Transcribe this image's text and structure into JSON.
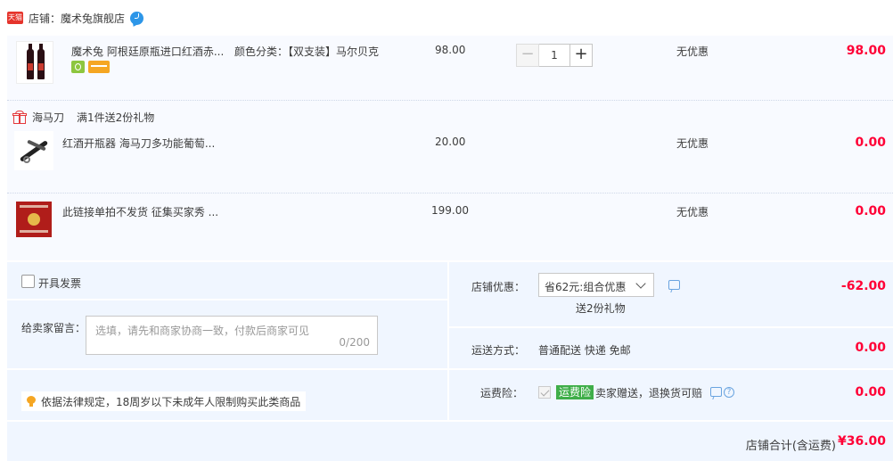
{
  "shop": {
    "badge": "天猫",
    "label": "店铺：魔术兔旗舰店"
  },
  "items": [
    {
      "title": "魔术兔 阿根廷原瓶进口红酒赤...",
      "sku": "颜色分类：【双支装】马尔贝克",
      "price": "98.00",
      "qty": "1",
      "discount": "无优惠",
      "subtotal": "98.00"
    },
    {
      "title": "红酒开瓶器 海马刀多功能葡萄...",
      "price": "20.00",
      "discount": "无优惠",
      "subtotal": "0.00"
    },
    {
      "title": "此链接单拍不发货 征集买家秀 ...",
      "price": "199.00",
      "discount": "无优惠",
      "subtotal": "0.00"
    }
  ],
  "gift": {
    "name": "海马刀",
    "rule": "满1件送2份礼物"
  },
  "invoice": {
    "label": "开具发票",
    "checked": false
  },
  "message": {
    "label": "给卖家留言：",
    "placeholder": "选填，请先和商家协商一致，付款后商家可见",
    "count": "0/200"
  },
  "notice": "依据法律规定，18周岁以下未成年人限制购买此类商品",
  "shop_discount": {
    "label": "店铺优惠：",
    "selected": "省62元:组合优惠",
    "sub": "送2份礼物",
    "amount": "-62.00"
  },
  "shipping": {
    "label": "运送方式：",
    "value": "普通配送 快递 免邮",
    "amount": "0.00"
  },
  "insurance": {
    "label": "运费险：",
    "badge": "运费险",
    "text": "卖家赠送，退换货可赔",
    "amount": "0.00"
  },
  "total": {
    "label": "店铺合计(含运费)",
    "value": "¥36.00"
  },
  "colors": {
    "accent": "#ff0036",
    "panel": "#f0f6ff",
    "tmall": "#e5342c",
    "insurance": "#3fae49"
  },
  "icons": [
    "tmall-icon",
    "chat-icon",
    "gift-icon",
    "bulb-icon",
    "comment-icon",
    "help-icon",
    "chevron-down-icon"
  ]
}
